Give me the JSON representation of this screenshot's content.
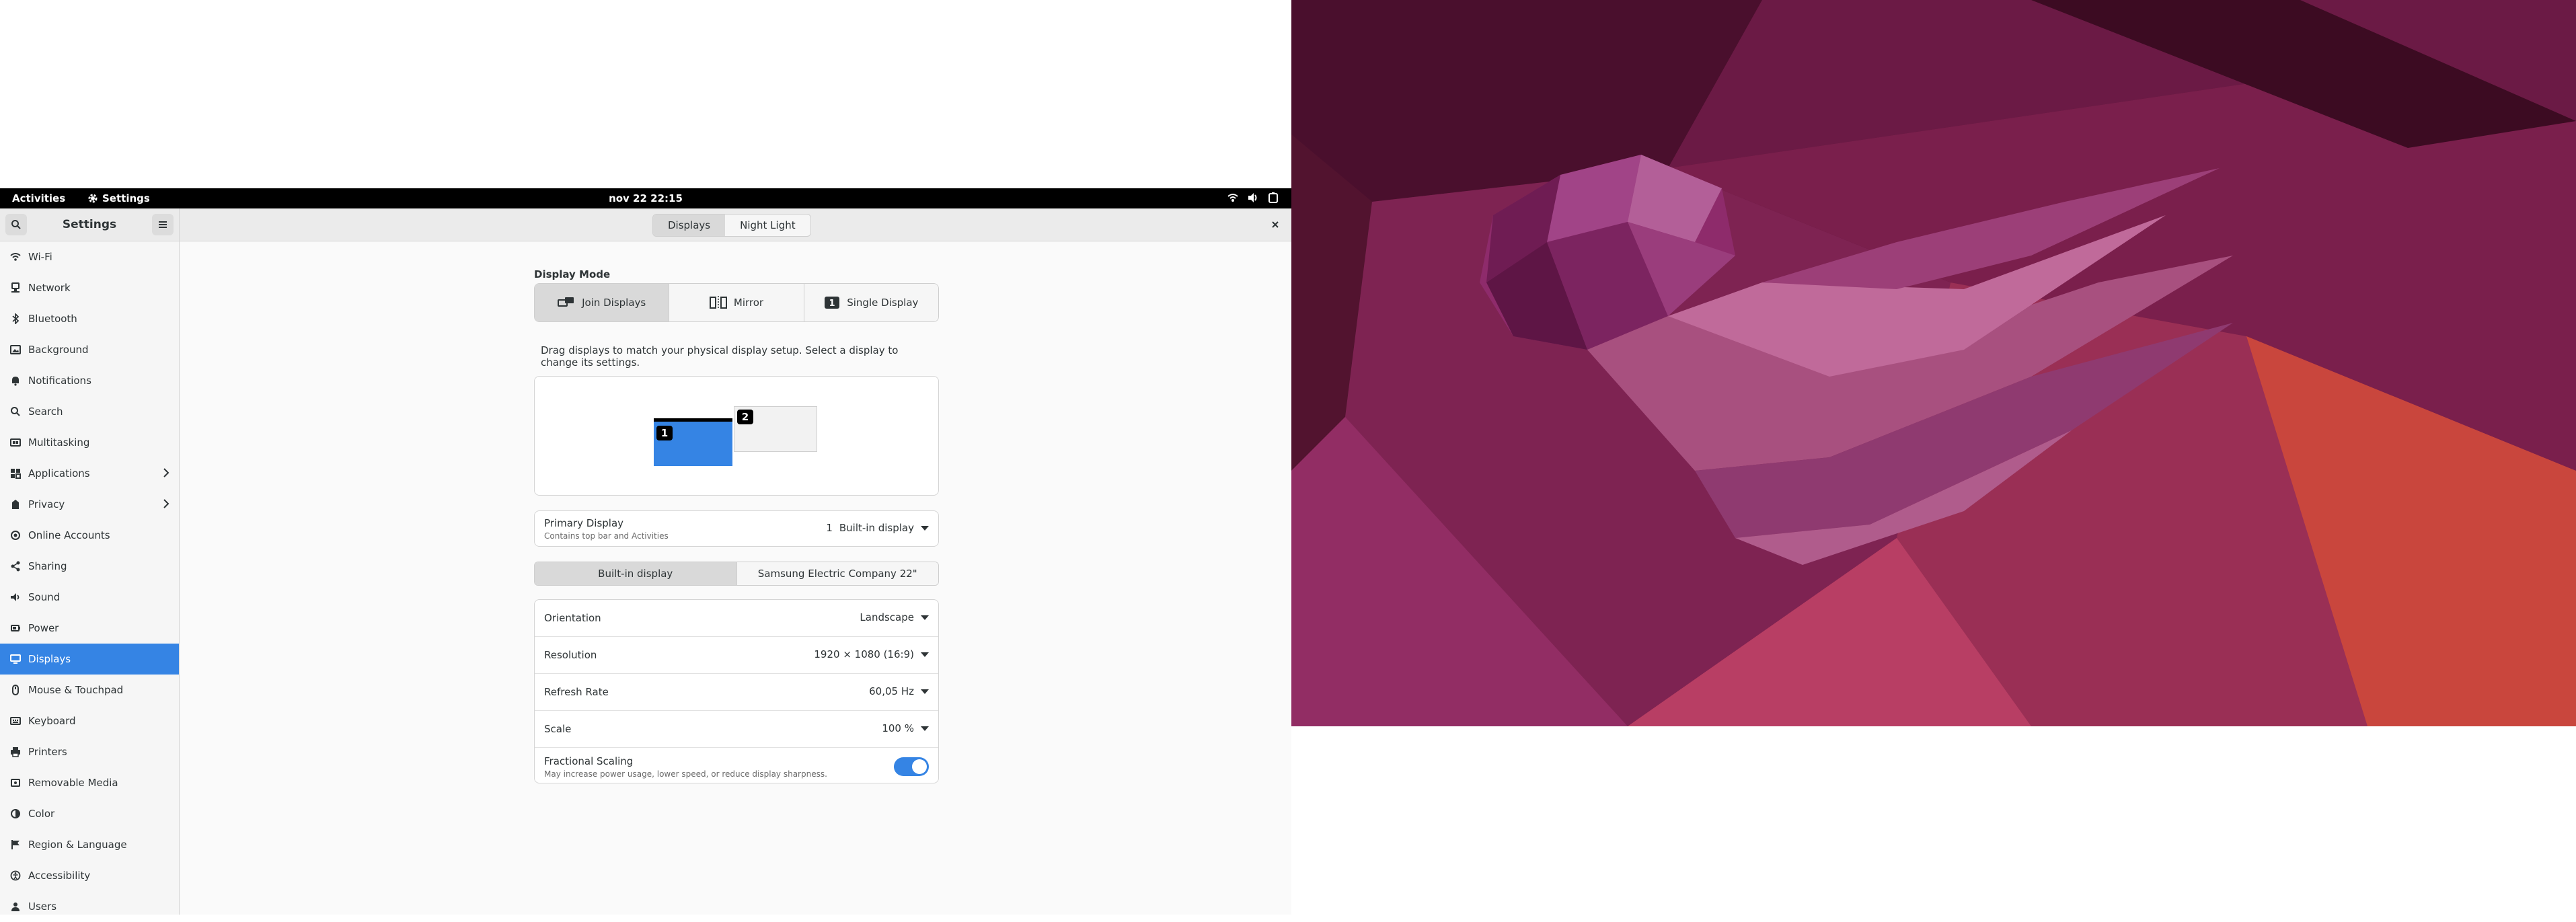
{
  "topbar": {
    "activities": "Activities",
    "app_name": "Settings",
    "clock": "nov 22 22:15"
  },
  "headerbar": {
    "sidebar_title": "Settings",
    "tabs": [
      {
        "label": "Displays",
        "active": true
      },
      {
        "label": "Night Light",
        "active": false
      }
    ]
  },
  "sidebar": {
    "items": [
      {
        "label": "Wi-Fi",
        "icon": "wifi-icon"
      },
      {
        "label": "Network",
        "icon": "network-icon"
      },
      {
        "label": "Bluetooth",
        "icon": "bluetooth-icon"
      },
      {
        "label": "Background",
        "icon": "background-icon"
      },
      {
        "label": "Notifications",
        "icon": "bell-icon"
      },
      {
        "label": "Search",
        "icon": "search-icon"
      },
      {
        "label": "Multitasking",
        "icon": "multitasking-icon"
      },
      {
        "label": "Applications",
        "icon": "applications-icon",
        "chevron": true
      },
      {
        "label": "Privacy",
        "icon": "privacy-icon",
        "chevron": true
      },
      {
        "label": "Online Accounts",
        "icon": "online-accounts-icon"
      },
      {
        "label": "Sharing",
        "icon": "sharing-icon"
      },
      {
        "label": "Sound",
        "icon": "sound-icon"
      },
      {
        "label": "Power",
        "icon": "power-icon"
      },
      {
        "label": "Displays",
        "icon": "display-icon",
        "selected": true
      },
      {
        "label": "Mouse & Touchpad",
        "icon": "mouse-icon"
      },
      {
        "label": "Keyboard",
        "icon": "keyboard-icon"
      },
      {
        "label": "Printers",
        "icon": "printer-icon"
      },
      {
        "label": "Removable Media",
        "icon": "removable-media-icon"
      },
      {
        "label": "Color",
        "icon": "color-icon"
      },
      {
        "label": "Region & Language",
        "icon": "flag-icon"
      },
      {
        "label": "Accessibility",
        "icon": "accessibility-icon"
      },
      {
        "label": "Users",
        "icon": "users-icon"
      }
    ]
  },
  "display": {
    "mode_title": "Display Mode",
    "modes": [
      {
        "label": "Join Displays",
        "active": true
      },
      {
        "label": "Mirror",
        "active": false
      },
      {
        "label": "Single Display",
        "active": false
      }
    ],
    "hint": "Drag displays to match your physical display setup. Select a display to change its settings.",
    "monitors": [
      {
        "number": "1",
        "color": "#3584e4",
        "primary": true
      },
      {
        "number": "2",
        "color": "#f2f2f2",
        "primary": false
      }
    ],
    "primary": {
      "title": "Primary Display",
      "subtitle": "Contains top bar and Activities",
      "number": "1",
      "value": "Built-in display"
    },
    "tabs": [
      {
        "label": "Built-in display",
        "active": true
      },
      {
        "label": "Samsung Electric Company 22\"",
        "active": false
      }
    ],
    "settings": {
      "orientation": {
        "label": "Orientation",
        "value": "Landscape"
      },
      "resolution": {
        "label": "Resolution",
        "value": "1920 × 1080 (16:9)"
      },
      "refresh": {
        "label": "Refresh Rate",
        "value": "60,05 Hz"
      },
      "scale": {
        "label": "Scale",
        "value": "100 %"
      },
      "fractional": {
        "label": "Fractional Scaling",
        "subtitle": "May increase power usage, lower speed, or reduce display sharpness.",
        "enabled": true
      }
    }
  },
  "colors": {
    "accent": "#3584e4",
    "wallpaper_base": "#5a1738"
  }
}
